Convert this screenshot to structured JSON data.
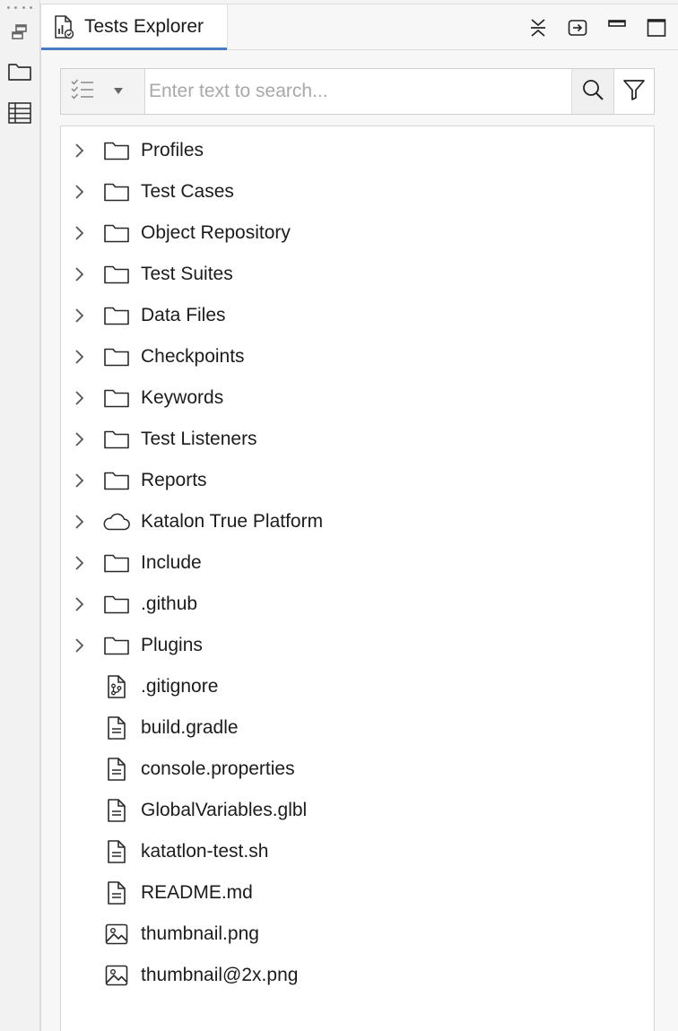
{
  "panel": {
    "tab_title": "Tests Explorer",
    "tab_icon": "test-report-icon",
    "actions": [
      "collapse-all-icon",
      "link-editor-icon",
      "minimize-icon",
      "maximize-icon"
    ]
  },
  "sidebar": {
    "items": [
      "minimized-views-icon",
      "folder-icon",
      "table-icon"
    ]
  },
  "search": {
    "placeholder": "Enter text to search...",
    "value": ""
  },
  "tree": {
    "items": [
      {
        "label": "Profiles",
        "type": "folder",
        "expandable": true
      },
      {
        "label": "Test Cases",
        "type": "folder",
        "expandable": true
      },
      {
        "label": "Object Repository",
        "type": "folder",
        "expandable": true
      },
      {
        "label": "Test Suites",
        "type": "folder",
        "expandable": true
      },
      {
        "label": "Data Files",
        "type": "folder",
        "expandable": true
      },
      {
        "label": "Checkpoints",
        "type": "folder",
        "expandable": true
      },
      {
        "label": "Keywords",
        "type": "folder",
        "expandable": true
      },
      {
        "label": "Test Listeners",
        "type": "folder",
        "expandable": true
      },
      {
        "label": "Reports",
        "type": "folder",
        "expandable": true
      },
      {
        "label": "Katalon True Platform",
        "type": "cloud",
        "expandable": true
      },
      {
        "label": "Include",
        "type": "folder",
        "expandable": true
      },
      {
        "label": ".github",
        "type": "folder",
        "expandable": true
      },
      {
        "label": "Plugins",
        "type": "folder",
        "expandable": true
      },
      {
        "label": ".gitignore",
        "type": "git-file",
        "expandable": false
      },
      {
        "label": "build.gradle",
        "type": "file",
        "expandable": false
      },
      {
        "label": "console.properties",
        "type": "file",
        "expandable": false
      },
      {
        "label": "GlobalVariables.glbl",
        "type": "file",
        "expandable": false
      },
      {
        "label": "katatlon-test.sh",
        "type": "file",
        "expandable": false
      },
      {
        "label": "README.md",
        "type": "file",
        "expandable": false
      },
      {
        "label": "thumbnail.png",
        "type": "image",
        "expandable": false
      },
      {
        "label": "thumbnail@2x.png",
        "type": "image",
        "expandable": false
      }
    ]
  }
}
